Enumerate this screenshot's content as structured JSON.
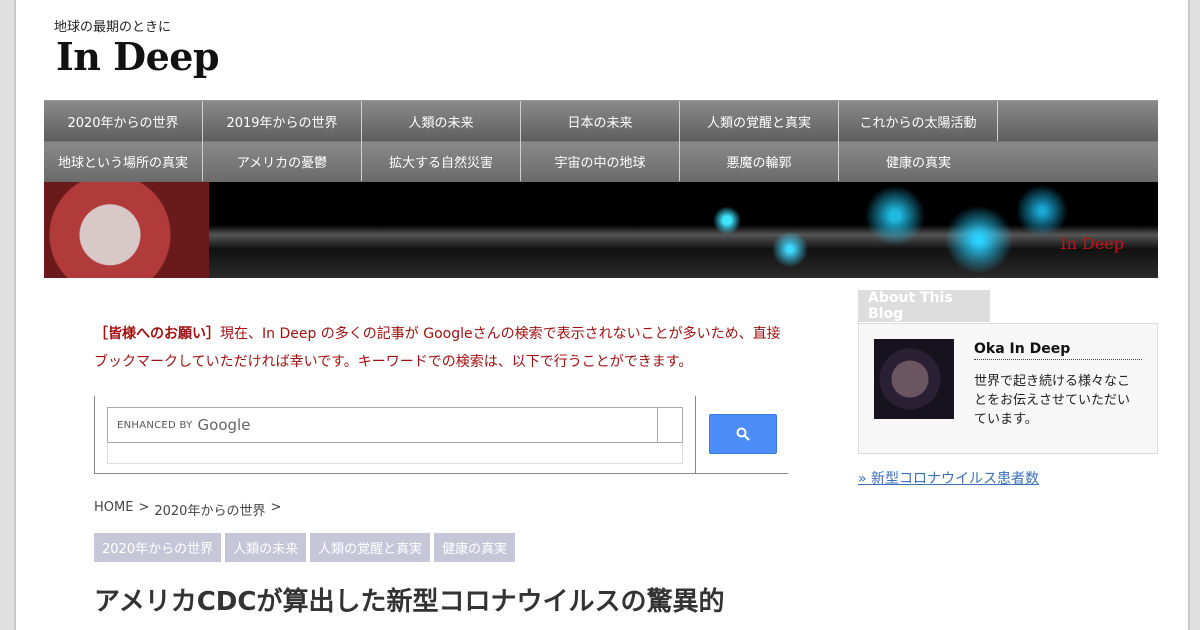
{
  "site": {
    "tagline": "地球の最期のときに",
    "logo": "In Deep"
  },
  "nav": {
    "row1": [
      "2020年からの世界",
      "2019年からの世界",
      "人類の未来",
      "日本の未来",
      "人類の覚醒と真実",
      "これからの太陽活動"
    ],
    "row2": [
      "地球という場所の真実",
      "アメリカの憂鬱",
      "拡大する自然災害",
      "宇宙の中の地球",
      "悪魔の輪郭",
      "健康の真実"
    ]
  },
  "banner": {
    "brand": "In Deep"
  },
  "notice": {
    "lead": "［皆様へのお願い］",
    "text": "現在、In Deep の多くの記事が Googleさんの検索で表示されないことが多いため、直接ブックマークしていただければ幸いです。キーワードでの検索は、以下で行うことができます。"
  },
  "search": {
    "enhanced": "ENHANCED BY",
    "google": "Google",
    "button_icon": "search-icon"
  },
  "breadcrumb": {
    "home": "HOME",
    "sep": ">",
    "category": "2020年からの世界",
    "sep2": ">"
  },
  "tags": [
    "2020年からの世界",
    "人類の未来",
    "人類の覚醒と真実",
    "健康の真実"
  ],
  "article": {
    "title": "アメリカCDCが算出した新型コロナウイルスの驚異的"
  },
  "sidebar": {
    "about_title": "About This Blog",
    "author": "Oka In Deep",
    "about_text": "世界で起き続ける様々なことをお伝えさせていただいています。",
    "link": "» 新型コロナウイルス患者数"
  },
  "colors": {
    "notice_red": "#a01010",
    "search_blue": "#4d8df7",
    "link_blue": "#3a70b8",
    "tag_bg": "#c6c6d8"
  }
}
